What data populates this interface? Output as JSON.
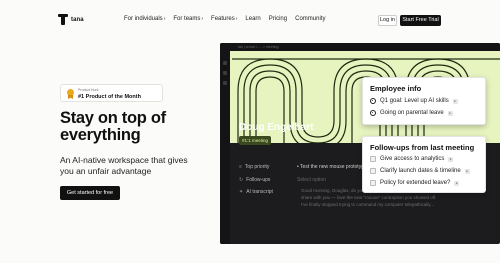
{
  "nav": {
    "logo_text": "tana",
    "menu": [
      {
        "label": "For individuals",
        "chevron": "›"
      },
      {
        "label": "For teams",
        "chevron": "›"
      },
      {
        "label": "Features",
        "chevron": "›"
      },
      {
        "label": "Learn",
        "chevron": ""
      },
      {
        "label": "Pricing",
        "chevron": ""
      },
      {
        "label": "Community",
        "chevron": ""
      }
    ],
    "login_label": "Log in",
    "trial_label": "Start Free Trial"
  },
  "badge": {
    "small": "Product Hunt",
    "big": "#1 Product of the Month",
    "icon": "medal-icon"
  },
  "hero": {
    "headline": "Stay on top of everything",
    "subhead": "An AI-native workspace that gives you an unfair advantage",
    "cta_label": "Get started for free"
  },
  "app": {
    "breadcrumb": "tab | crowd > ... > meeting",
    "person": "Doug Engelbart",
    "tag": "#1:1 meeting",
    "fields": [
      {
        "icon": "≡",
        "label": "Top priority",
        "value": "• Test the new mouse prototype",
        "muted": false
      },
      {
        "icon": "↻",
        "label": "Follow-ups",
        "value": "Select option",
        "muted": true
      },
      {
        "icon": "✦",
        "label": "AI transcript",
        "value": "",
        "muted": false
      }
    ],
    "transcript": "Good morning, Douglas, do you have a moment? I just wanted to share with you — love the new \"mouse\" contraption you showed off. I've finally stopped trying to command my computer telepathically..."
  },
  "employee_card": {
    "title": "Employee info",
    "items": [
      "Q1 goal: Level up AI skills",
      "Going on parental leave"
    ]
  },
  "followup_card": {
    "title": "Follow-ups from last meeting",
    "items": [
      "Give access to analytics",
      "Clarify launch dates & timeline",
      "Policy for extended leave?"
    ]
  },
  "colors": {
    "accent_green": "#e7f4c0",
    "dark_bg": "#1c1c1e",
    "button_black": "#111111"
  }
}
